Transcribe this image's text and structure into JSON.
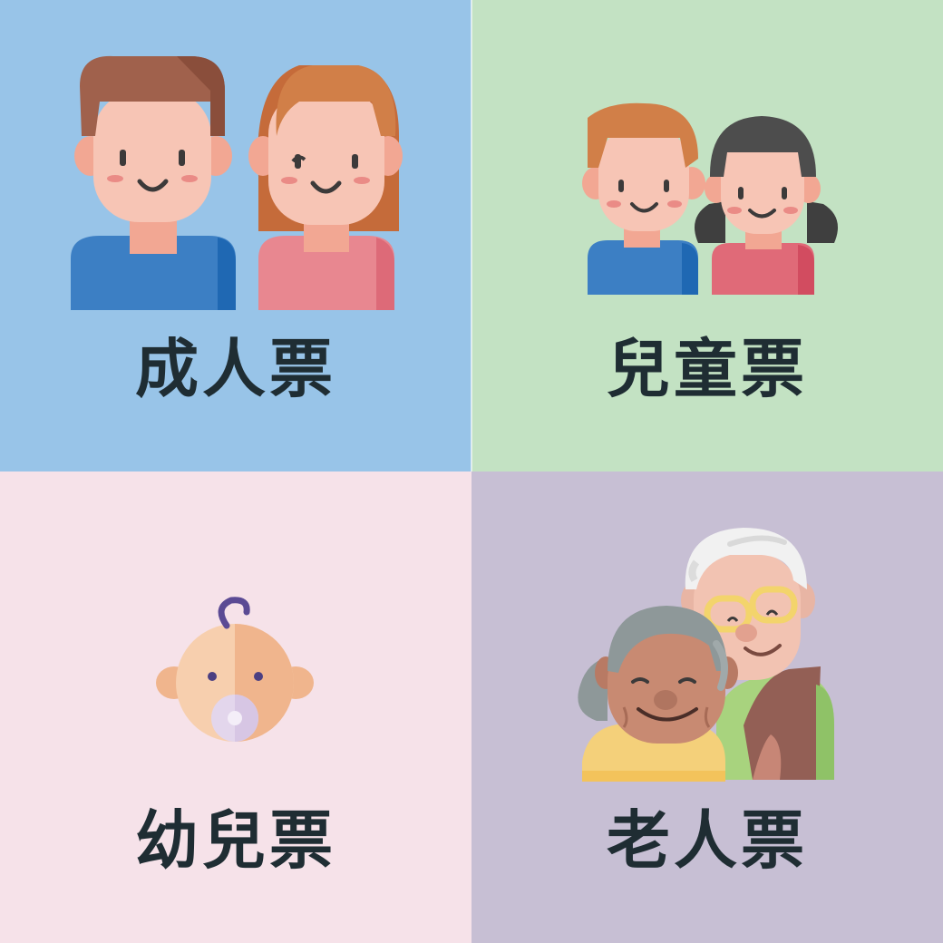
{
  "tiles": [
    {
      "id": "adult",
      "label": "成人票",
      "icon": "adult-couple-icon",
      "background": "#98c4e8"
    },
    {
      "id": "child",
      "label": "兒童票",
      "icon": "children-icon",
      "background": "#c3e2c3"
    },
    {
      "id": "infant",
      "label": "幼兒票",
      "icon": "baby-icon",
      "background": "#f6e2e9"
    },
    {
      "id": "senior",
      "label": "老人票",
      "icon": "elderly-couple-icon",
      "background": "#c7bfd4"
    }
  ]
}
